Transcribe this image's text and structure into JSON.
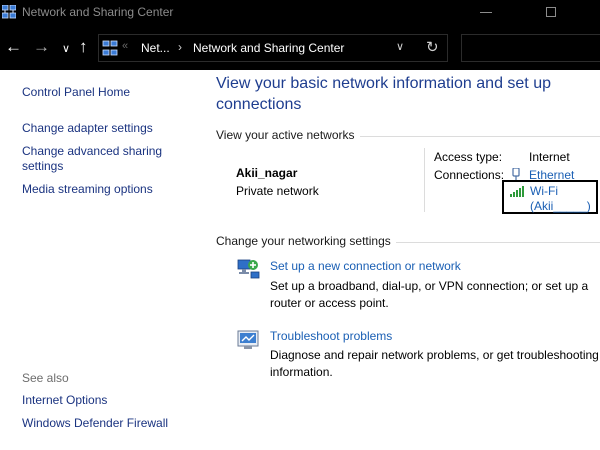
{
  "window": {
    "title": "Network and Sharing Center"
  },
  "address": {
    "crumb_1": "Net...",
    "crumb_2": "Network and Sharing Center"
  },
  "left_pane": {
    "home": "Control Panel Home",
    "adapter": "Change adapter settings",
    "advanced": "Change advanced sharing settings",
    "media": "Media streaming options",
    "see_also": "See also",
    "internet_options": "Internet Options",
    "firewall": "Windows Defender Firewall"
  },
  "main": {
    "title": "View your basic network information and set up connections",
    "active_networks_heading": "View your active networks",
    "network": {
      "name": "Akii_nagar",
      "type": "Private network",
      "access_type_label": "Access type:",
      "access_type_value": "Internet",
      "connections_label": "Connections:",
      "ethernet": "Ethernet",
      "wifi": "Wi-Fi",
      "wifi_sub": "(Akii_____)"
    },
    "change_heading": "Change your networking settings",
    "tasks": [
      {
        "label": "Set up a new connection or network",
        "description": "Set up a broadband, dial-up, or VPN connection; or set up a router or access point.",
        "icon": "new-connection-icon"
      },
      {
        "label": "Troubleshoot problems",
        "description": "Diagnose and repair network problems, or get troubleshooting information.",
        "icon": "troubleshoot-icon"
      }
    ]
  },
  "colors": {
    "link": "#1a5fb4",
    "title": "#1e3d8f",
    "chrome": "#000000",
    "highlight_box": "#000000"
  }
}
